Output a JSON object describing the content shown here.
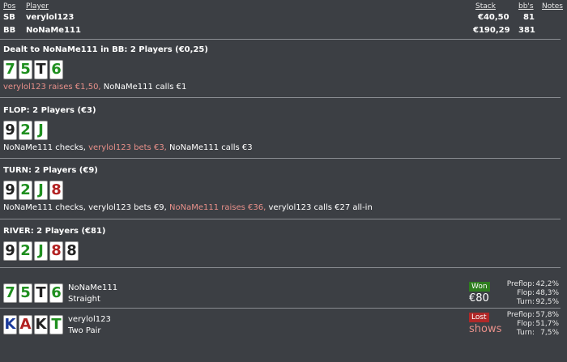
{
  "header": {
    "pos": "Pos",
    "player": "Player",
    "stack": "Stack",
    "bbs": "bb's",
    "notes": "Notes"
  },
  "players": [
    {
      "pos": "SB",
      "name": "verylol123",
      "stack": "€40,50",
      "bbs": "81"
    },
    {
      "pos": "BB",
      "name": "NoNaMe111",
      "stack": "€190,29",
      "bbs": "381"
    }
  ],
  "preflop": {
    "title": "Dealt to NoNaMe111 in BB: 2 Players (€0,25)",
    "cards": [
      {
        "rank": "7",
        "color": "#1f8f1f"
      },
      {
        "rank": "5",
        "color": "#1f8f1f"
      },
      {
        "rank": "T",
        "color": "#222222"
      },
      {
        "rank": "6",
        "color": "#1f8f1f"
      }
    ],
    "action_1": "verylol123 raises €1,50,",
    "action_2": " NoNaMe111 calls €1"
  },
  "flop": {
    "title": "FLOP: 2 Players (€3)",
    "cards": [
      {
        "rank": "9",
        "color": "#222222"
      },
      {
        "rank": "2",
        "color": "#1f8f1f"
      },
      {
        "rank": "J",
        "color": "#1f8f1f"
      }
    ],
    "action_1": "NoNaMe111 checks,",
    "action_2": " verylol123 bets €3,",
    "action_3": " NoNaMe111 calls €3"
  },
  "turn": {
    "title": "TURN: 2 Players (€9)",
    "cards": [
      {
        "rank": "9",
        "color": "#222222"
      },
      {
        "rank": "2",
        "color": "#1f8f1f"
      },
      {
        "rank": "J",
        "color": "#1f8f1f"
      },
      {
        "rank": "8",
        "color": "#b22222"
      }
    ],
    "action_1": "NoNaMe111 checks, verylol123 bets €9,",
    "action_2": " NoNaMe111 raises €36,",
    "action_3": " verylol123 calls €27 all-in"
  },
  "river": {
    "title": "RIVER: 2 Players (€81)",
    "cards": [
      {
        "rank": "9",
        "color": "#222222"
      },
      {
        "rank": "2",
        "color": "#1f8f1f"
      },
      {
        "rank": "J",
        "color": "#1f8f1f"
      },
      {
        "rank": "8",
        "color": "#b22222"
      },
      {
        "rank": "8",
        "color": "#222222"
      }
    ]
  },
  "showdown": [
    {
      "name": "NoNaMe111",
      "hand": "Straight",
      "cards": [
        {
          "rank": "7",
          "color": "#1f8f1f"
        },
        {
          "rank": "5",
          "color": "#1f8f1f"
        },
        {
          "rank": "T",
          "color": "#222222"
        },
        {
          "rank": "6",
          "color": "#1f8f1f"
        }
      ],
      "result_badge": "Won",
      "result_value": "€80",
      "equity": [
        {
          "label": "Preflop:",
          "value": "42,2%"
        },
        {
          "label": "Flop:",
          "value": "48,3%"
        },
        {
          "label": "Turn:",
          "value": "92,5%"
        }
      ]
    },
    {
      "name": "verylol123",
      "hand": "Two Pair",
      "cards": [
        {
          "rank": "K",
          "color": "#1a3a9a"
        },
        {
          "rank": "A",
          "color": "#b22222"
        },
        {
          "rank": "K",
          "color": "#222222"
        },
        {
          "rank": "T",
          "color": "#1f8f1f"
        }
      ],
      "result_badge": "Lost",
      "result_value": "shows",
      "equity": [
        {
          "label": "Preflop:",
          "value": "57,8%"
        },
        {
          "label": "Flop:",
          "value": "51,7%"
        },
        {
          "label": "Turn:",
          "value": "7,5%"
        }
      ]
    }
  ]
}
